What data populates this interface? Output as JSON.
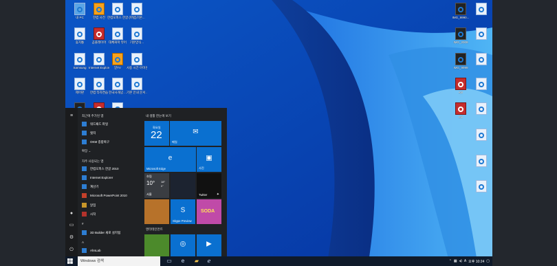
{
  "desktop_left": [
    {
      "label": "내 PC",
      "kind": "pc"
    },
    {
      "label": "한컴 사전",
      "kind": "gold"
    },
    {
      "label": "한컴오피스 한글 2010",
      "kind": "normal"
    },
    {
      "label": "(마법)기본...",
      "kind": "normal"
    },
    {
      "label": "휴지통",
      "kind": "normal"
    },
    {
      "label": "곰플레이어",
      "kind": "red"
    },
    {
      "label": "대체화학 뷰어",
      "kind": "normal"
    },
    {
      "label": "기본양식...",
      "kind": "normal"
    },
    {
      "label": "Samsung",
      "kind": "normal"
    },
    {
      "label": "Internet Explorer",
      "kind": "normal"
    },
    {
      "label": "알TV",
      "kind": "gold"
    },
    {
      "label": "사용 시간 아이콘 설정",
      "kind": "normal"
    },
    {
      "label": "제어판",
      "kind": "normal"
    },
    {
      "label": "한컴 타자연습",
      "kind": "normal"
    },
    {
      "label": "한국사개념 ...",
      "kind": "normal"
    },
    {
      "label": "기본 안내 문서...",
      "kind": "normal"
    },
    {
      "label": "ZIP",
      "kind": "dark"
    },
    {
      "label": "",
      "kind": "red"
    },
    {
      "label": "",
      "kind": "normal"
    }
  ],
  "desktop_right": [
    {
      "label": "IMG_9990...",
      "kind": "dark"
    },
    {
      "label": "",
      "kind": "normal"
    },
    {
      "label": "IMG_2009",
      "kind": "dark"
    },
    {
      "label": "",
      "kind": "normal"
    },
    {
      "label": "IMG_9999",
      "kind": "dark"
    },
    {
      "label": "",
      "kind": "normal"
    },
    {
      "label": "AVI",
      "kind": "red"
    },
    {
      "label": "",
      "kind": "normal"
    },
    {
      "label": "AVI",
      "kind": "red"
    },
    {
      "label": "",
      "kind": "normal"
    },
    {
      "label": "",
      "kind": "normal"
    },
    {
      "label": "",
      "kind": "normal"
    },
    {
      "label": "",
      "kind": "normal"
    },
    {
      "label": "",
      "kind": "normal"
    }
  ],
  "start_menu": {
    "recent_header": "최근에 추가된 앱",
    "recent_items": [
      "워드패드 파일",
      "엣지",
      "OKM 종합복구"
    ],
    "expand_label": "확장",
    "frequent_header": "자주 사용되는 앱",
    "frequent_items": [
      "한컴오피스 한글 2010",
      "Internet Explorer",
      "계산기",
      "Microsoft PowerPoint 2010",
      "알집",
      "시작"
    ],
    "section_hash": "#",
    "section_items": [
      "3D Builder\n새로 설치됨"
    ],
    "section_a": "A",
    "a_items": [
      "AhnLab"
    ],
    "tiles_header": "내 생활 한눈에 보기",
    "play_header": "엔터테인먼트",
    "tiles": {
      "calendar_day": "화요일",
      "calendar_date": "22",
      "mail": "메일",
      "edge": "Microsoft Edge",
      "photos": "사진",
      "weather_city": "흐림",
      "weather_temp": "10°",
      "weather_hi": "18°",
      "weather_lo": "8°",
      "weather_place": "서울",
      "twitter": "Twitter",
      "candy": "",
      "skype": "Skype Preview",
      "soda": "SODA",
      "minecraft": "",
      "groove": "",
      "movies": ""
    }
  },
  "taskbar": {
    "search_placeholder": "Windows 검색",
    "tray_lang": "A",
    "tray_time": "오후 10:24"
  }
}
